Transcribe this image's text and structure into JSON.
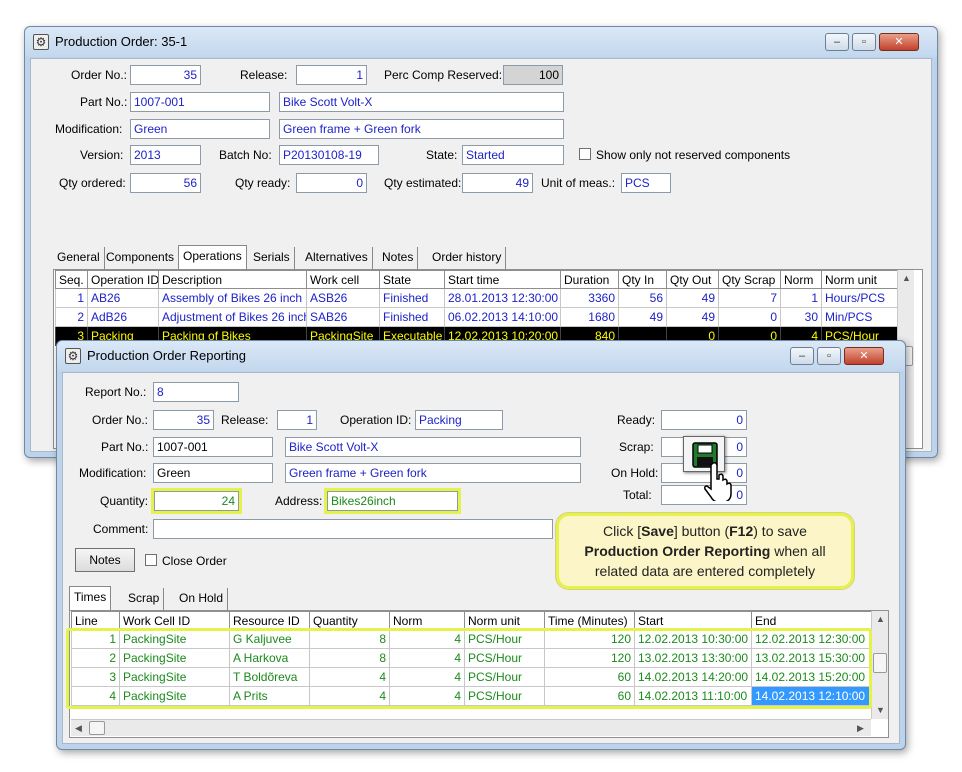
{
  "main_window": {
    "title": "Production Order: 35-1",
    "labels": {
      "order_no": "Order No.:",
      "release": "Release:",
      "perc_comp_reserved": "Perc Comp Reserved:",
      "part_no": "Part No.:",
      "modification": "Modification:",
      "version": "Version:",
      "batch_no": "Batch No:",
      "state": "State:",
      "show_only": "Show only not reserved components",
      "qty_ordered": "Qty ordered:",
      "qty_ready": "Qty ready:",
      "qty_estimated": "Qty estimated:",
      "unit_of_meas": "Unit of meas.:"
    },
    "values": {
      "order_no": "35",
      "release": "1",
      "perc_comp_reserved": "100",
      "part_no": "1007-001",
      "part_name": "Bike Scott Volt-X",
      "modification": "Green",
      "modification_desc": "Green frame + Green fork",
      "version": "2013",
      "batch_no": "P20130108-19",
      "state": "Started",
      "qty_ordered": "56",
      "qty_ready": "0",
      "qty_estimated": "49",
      "unit_of_meas": "PCS"
    },
    "tabs": [
      "General",
      "Components",
      "Operations",
      "Serials",
      "Alternatives",
      "Notes",
      "Order history"
    ],
    "active_tab": "Operations",
    "ops_columns": [
      "Seq.",
      "Operation ID",
      "Description",
      "Work cell",
      "State",
      "Start time",
      "Duration",
      "Qty In",
      "Qty Out",
      "Qty Scrap",
      "Norm",
      "Norm unit"
    ],
    "ops_rows": [
      [
        "1",
        "AB26",
        "Assembly of Bikes 26 inch",
        "ASB26",
        "Finished",
        "28.01.2013 12:30:00",
        "3360",
        "56",
        "49",
        "7",
        "1",
        "Hours/PCS"
      ],
      [
        "2",
        "AdB26",
        "Adjustment of Bikes 26 inch",
        "SAB26",
        "Finished",
        "06.02.2013 14:10:00",
        "1680",
        "49",
        "49",
        "0",
        "30",
        "Min/PCS"
      ],
      [
        "3",
        "Packing",
        "Packing of Bikes",
        "PackingSite",
        "Executable",
        "12.02.2013 10:20:00",
        "840",
        "",
        "0",
        "0",
        "4",
        "PCS/Hour"
      ]
    ]
  },
  "report_window": {
    "title": "Production Order Reporting",
    "labels": {
      "report_no": "Report No.:",
      "order_no": "Order No.:",
      "release": "Release:",
      "operation_id": "Operation ID:",
      "part_no": "Part No.:",
      "modification": "Modification:",
      "quantity": "Quantity:",
      "address": "Address:",
      "comment": "Comment:",
      "ready": "Ready:",
      "scrap": "Scrap:",
      "on_hold": "On Hold:",
      "total": "Total:"
    },
    "values": {
      "report_no": "8",
      "order_no": "35",
      "release": "1",
      "operation_id": "Packing",
      "part_no": "1007-001",
      "part_name": "Bike Scott Volt-X",
      "modification": "Green",
      "modification_desc": "Green frame + Green fork",
      "quantity": "24",
      "address": "Bikes26inch",
      "comment": "",
      "ready": "0",
      "scrap": "0",
      "on_hold": "0",
      "total": "0"
    },
    "notes_button": "Notes",
    "close_order": "Close Order",
    "tabs": [
      "Times",
      "Scrap",
      "On Hold"
    ],
    "active_tab": "Times",
    "times_columns": [
      "Line",
      "Work Cell ID",
      "Resource ID",
      "Quantity",
      "Norm",
      "Norm unit",
      "Time (Minutes)",
      "Start",
      "End"
    ],
    "times_rows": [
      [
        "1",
        "PackingSite",
        "G Kaljuvee",
        "8",
        "4",
        "PCS/Hour",
        "120",
        "12.02.2013 10:30:00",
        "12.02.2013 12:30:00"
      ],
      [
        "2",
        "PackingSite",
        "A Harkova",
        "8",
        "4",
        "PCS/Hour",
        "120",
        "13.02.2013 13:30:00",
        "13.02.2013 15:30:00"
      ],
      [
        "3",
        "PackingSite",
        "T Boldõreva",
        "4",
        "4",
        "PCS/Hour",
        "60",
        "14.02.2013 14:20:00",
        "14.02.2013 15:20:00"
      ],
      [
        "4",
        "PackingSite",
        "A Prits",
        "4",
        "4",
        "PCS/Hour",
        "60",
        "14.02.2013 11:10:00",
        "14.02.2013 12:10:00"
      ]
    ]
  },
  "callout": {
    "t1": "Click [",
    "save": "Save",
    "t2": "] button (",
    "f12": "F12",
    "t3": ") to save",
    "l2": "Production  Order Reporting",
    "l2b": " when all",
    "l3": "related data are entered completely"
  },
  "colors": {
    "highlight": "#e4f24a",
    "value_blue": "#1d22c9",
    "value_green": "#1b8a1b",
    "selected_row": "#000000",
    "selected_text": "#ffff00"
  },
  "icons": [
    "app-icon",
    "minimize-icon",
    "maximize-icon",
    "close-icon",
    "save-icon",
    "hand-cursor-icon"
  ]
}
